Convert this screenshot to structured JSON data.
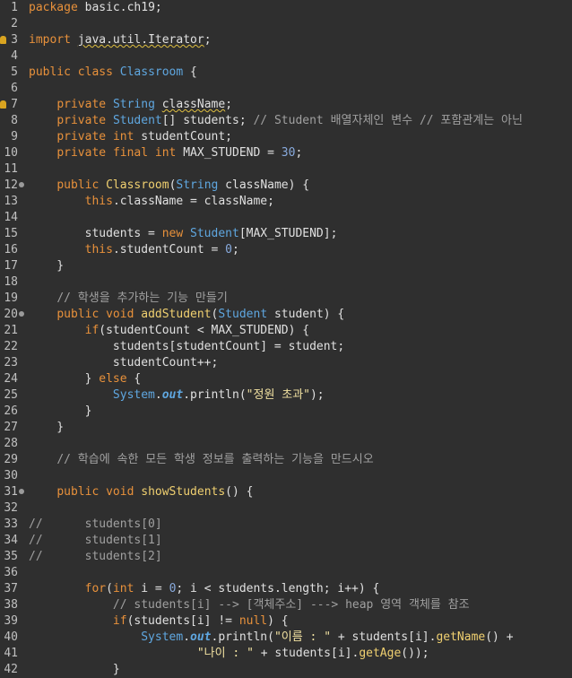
{
  "editor": {
    "lines": [
      {
        "n": "1",
        "tokens": [
          [
            "kw",
            "package"
          ],
          [
            "t",
            " basic.ch19;"
          ]
        ]
      },
      {
        "n": "2",
        "tokens": []
      },
      {
        "n": "3",
        "marker": true,
        "tokens": [
          [
            "kw",
            "import"
          ],
          [
            "t",
            " "
          ],
          [
            "warn",
            "java.util.Iterator"
          ],
          [
            "t",
            ";"
          ]
        ]
      },
      {
        "n": "4",
        "tokens": []
      },
      {
        "n": "5",
        "tokens": [
          [
            "kw",
            "public"
          ],
          [
            "t",
            " "
          ],
          [
            "kw",
            "class"
          ],
          [
            "t",
            " "
          ],
          [
            "ty",
            "Classroom"
          ],
          [
            "t",
            " {"
          ]
        ]
      },
      {
        "n": "6",
        "tokens": []
      },
      {
        "n": "7",
        "marker": true,
        "tokens": [
          [
            "t",
            "    "
          ],
          [
            "kw",
            "private"
          ],
          [
            "t",
            " "
          ],
          [
            "ty",
            "String"
          ],
          [
            "t",
            " "
          ],
          [
            "warn",
            "className"
          ],
          [
            "t",
            ";"
          ]
        ]
      },
      {
        "n": "8",
        "tokens": [
          [
            "t",
            "    "
          ],
          [
            "kw",
            "private"
          ],
          [
            "t",
            " "
          ],
          [
            "ty",
            "Student"
          ],
          [
            "t",
            "[] students; "
          ],
          [
            "cm",
            "// Student 배열자체인 변수 // 포함관계는 아닌"
          ]
        ]
      },
      {
        "n": "9",
        "tokens": [
          [
            "t",
            "    "
          ],
          [
            "kw",
            "private"
          ],
          [
            "t",
            " "
          ],
          [
            "kw",
            "int"
          ],
          [
            "t",
            " studentCount;"
          ]
        ]
      },
      {
        "n": "10",
        "tokens": [
          [
            "t",
            "    "
          ],
          [
            "kw",
            "private"
          ],
          [
            "t",
            " "
          ],
          [
            "kw",
            "final"
          ],
          [
            "t",
            " "
          ],
          [
            "kw",
            "int"
          ],
          [
            "t",
            " MAX_STUDEND = "
          ],
          [
            "num",
            "30"
          ],
          [
            "t",
            ";"
          ]
        ]
      },
      {
        "n": "11",
        "tokens": []
      },
      {
        "n": "12",
        "fold": true,
        "tokens": [
          [
            "t",
            "    "
          ],
          [
            "kw",
            "public"
          ],
          [
            "t",
            " "
          ],
          [
            "fn",
            "Classroom"
          ],
          [
            "t",
            "("
          ],
          [
            "ty",
            "String"
          ],
          [
            "t",
            " className) {"
          ]
        ]
      },
      {
        "n": "13",
        "tokens": [
          [
            "t",
            "        "
          ],
          [
            "kw",
            "this"
          ],
          [
            "t",
            ".className = className;"
          ]
        ]
      },
      {
        "n": "14",
        "tokens": []
      },
      {
        "n": "15",
        "tokens": [
          [
            "t",
            "        students = "
          ],
          [
            "kw",
            "new"
          ],
          [
            "t",
            " "
          ],
          [
            "ty",
            "Student"
          ],
          [
            "t",
            "[MAX_STUDEND];"
          ]
        ]
      },
      {
        "n": "16",
        "tokens": [
          [
            "t",
            "        "
          ],
          [
            "kw",
            "this"
          ],
          [
            "t",
            ".studentCount = "
          ],
          [
            "num",
            "0"
          ],
          [
            "t",
            ";"
          ]
        ]
      },
      {
        "n": "17",
        "tokens": [
          [
            "t",
            "    }"
          ]
        ]
      },
      {
        "n": "18",
        "tokens": []
      },
      {
        "n": "19",
        "tokens": [
          [
            "t",
            "    "
          ],
          [
            "cm",
            "// 학생을 추가하는 기능 만들기"
          ]
        ]
      },
      {
        "n": "20",
        "fold": true,
        "tokens": [
          [
            "t",
            "    "
          ],
          [
            "kw",
            "public"
          ],
          [
            "t",
            " "
          ],
          [
            "kw",
            "void"
          ],
          [
            "t",
            " "
          ],
          [
            "fn",
            "addStudent"
          ],
          [
            "t",
            "("
          ],
          [
            "ty",
            "Student"
          ],
          [
            "t",
            " student) {"
          ]
        ]
      },
      {
        "n": "21",
        "tokens": [
          [
            "t",
            "        "
          ],
          [
            "kw",
            "if"
          ],
          [
            "t",
            "(studentCount < MAX_STUDEND) {"
          ]
        ]
      },
      {
        "n": "22",
        "tokens": [
          [
            "t",
            "            students[studentCount] = student;"
          ]
        ]
      },
      {
        "n": "23",
        "tokens": [
          [
            "t",
            "            studentCount++;"
          ]
        ]
      },
      {
        "n": "24",
        "tokens": [
          [
            "t",
            "        } "
          ],
          [
            "kw",
            "else"
          ],
          [
            "t",
            " {"
          ]
        ]
      },
      {
        "n": "25",
        "tokens": [
          [
            "t",
            "            "
          ],
          [
            "ty",
            "System"
          ],
          [
            "t",
            "."
          ],
          [
            "stat",
            "out"
          ],
          [
            "t",
            ".println("
          ],
          [
            "str",
            "\"정원 초과\""
          ],
          [
            "t",
            ");"
          ]
        ]
      },
      {
        "n": "26",
        "tokens": [
          [
            "t",
            "        }"
          ]
        ]
      },
      {
        "n": "27",
        "tokens": [
          [
            "t",
            "    }"
          ]
        ]
      },
      {
        "n": "28",
        "tokens": []
      },
      {
        "n": "29",
        "tokens": [
          [
            "t",
            "    "
          ],
          [
            "cm",
            "// 학습에 속한 모든 학생 정보를 출력하는 기능을 만드시오"
          ]
        ]
      },
      {
        "n": "30",
        "tokens": []
      },
      {
        "n": "31",
        "fold": true,
        "tokens": [
          [
            "t",
            "    "
          ],
          [
            "kw",
            "public"
          ],
          [
            "t",
            " "
          ],
          [
            "kw",
            "void"
          ],
          [
            "t",
            " "
          ],
          [
            "fn",
            "showStudents"
          ],
          [
            "t",
            "() {"
          ]
        ]
      },
      {
        "n": "32",
        "tokens": []
      },
      {
        "n": "33",
        "tokens": [
          [
            "cm",
            "//      students[0]"
          ]
        ]
      },
      {
        "n": "34",
        "tokens": [
          [
            "cm",
            "//      students[1]"
          ]
        ]
      },
      {
        "n": "35",
        "tokens": [
          [
            "cm",
            "//      students[2]"
          ]
        ]
      },
      {
        "n": "36",
        "tokens": []
      },
      {
        "n": "37",
        "tokens": [
          [
            "t",
            "        "
          ],
          [
            "kw",
            "for"
          ],
          [
            "t",
            "("
          ],
          [
            "kw",
            "int"
          ],
          [
            "t",
            " i = "
          ],
          [
            "num",
            "0"
          ],
          [
            "t",
            "; i < students.length; i++) {"
          ]
        ]
      },
      {
        "n": "38",
        "tokens": [
          [
            "t",
            "            "
          ],
          [
            "cm",
            "// students[i] --> [객체주소] ---> heap 영역 객체를 참조"
          ]
        ]
      },
      {
        "n": "39",
        "tokens": [
          [
            "t",
            "            "
          ],
          [
            "kw",
            "if"
          ],
          [
            "t",
            "(students[i] != "
          ],
          [
            "kw",
            "null"
          ],
          [
            "t",
            ") {"
          ]
        ]
      },
      {
        "n": "40",
        "tokens": [
          [
            "t",
            "                "
          ],
          [
            "ty",
            "System"
          ],
          [
            "t",
            "."
          ],
          [
            "stat",
            "out"
          ],
          [
            "t",
            ".println("
          ],
          [
            "str",
            "\"이름 : \""
          ],
          [
            "t",
            " + students[i]."
          ],
          [
            "fn",
            "getName"
          ],
          [
            "t",
            "() +"
          ]
        ]
      },
      {
        "n": "41",
        "tokens": [
          [
            "t",
            "                        "
          ],
          [
            "str",
            "\"나이 : \""
          ],
          [
            "t",
            " + students[i]."
          ],
          [
            "fn",
            "getAge"
          ],
          [
            "t",
            "());"
          ]
        ]
      },
      {
        "n": "42",
        "tokens": [
          [
            "t",
            "            }"
          ]
        ]
      }
    ]
  },
  "colors": {
    "background": "#2f2f2f",
    "keyword": "#e8913b",
    "type": "#5fa7e0",
    "method": "#f0d070",
    "string": "#f0e0a0",
    "comment": "#a0a0a0",
    "number": "#88aadd",
    "marker": "#d9a420"
  },
  "icons": {
    "warning_marker": "warning-icon",
    "fold_toggle": "fold-toggle-icon"
  }
}
